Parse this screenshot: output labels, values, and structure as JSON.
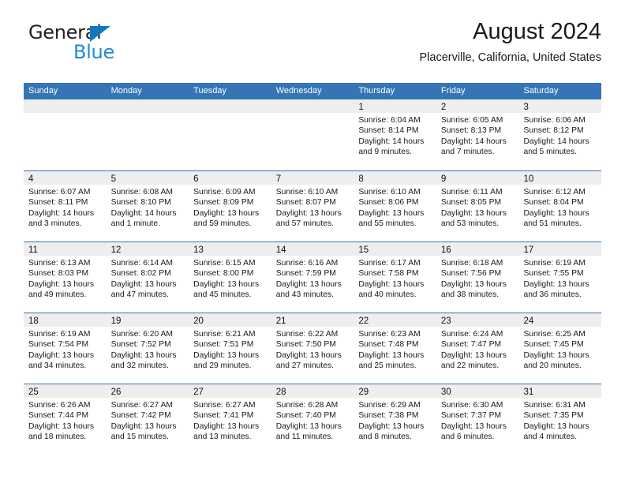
{
  "brand": {
    "name_top": "General",
    "name_bottom": "Blue",
    "triangle_color": "#1278be",
    "blue_color": "#1f8ad6"
  },
  "header": {
    "title": "August 2024",
    "subtitle": "Placerville, California, United States",
    "header_bar_color": "#3575b5",
    "day_band_color": "#eeeeee"
  },
  "weekdays": [
    "Sunday",
    "Monday",
    "Tuesday",
    "Wednesday",
    "Thursday",
    "Friday",
    "Saturday"
  ],
  "weeks": [
    [
      {
        "day": ""
      },
      {
        "day": ""
      },
      {
        "day": ""
      },
      {
        "day": ""
      },
      {
        "day": "1",
        "sunrise": "Sunrise: 6:04 AM",
        "sunset": "Sunset: 8:14 PM",
        "daylight_1": "Daylight: 14 hours",
        "daylight_2": "and 9 minutes."
      },
      {
        "day": "2",
        "sunrise": "Sunrise: 6:05 AM",
        "sunset": "Sunset: 8:13 PM",
        "daylight_1": "Daylight: 14 hours",
        "daylight_2": "and 7 minutes."
      },
      {
        "day": "3",
        "sunrise": "Sunrise: 6:06 AM",
        "sunset": "Sunset: 8:12 PM",
        "daylight_1": "Daylight: 14 hours",
        "daylight_2": "and 5 minutes."
      }
    ],
    [
      {
        "day": "4",
        "sunrise": "Sunrise: 6:07 AM",
        "sunset": "Sunset: 8:11 PM",
        "daylight_1": "Daylight: 14 hours",
        "daylight_2": "and 3 minutes."
      },
      {
        "day": "5",
        "sunrise": "Sunrise: 6:08 AM",
        "sunset": "Sunset: 8:10 PM",
        "daylight_1": "Daylight: 14 hours",
        "daylight_2": "and 1 minute."
      },
      {
        "day": "6",
        "sunrise": "Sunrise: 6:09 AM",
        "sunset": "Sunset: 8:09 PM",
        "daylight_1": "Daylight: 13 hours",
        "daylight_2": "and 59 minutes."
      },
      {
        "day": "7",
        "sunrise": "Sunrise: 6:10 AM",
        "sunset": "Sunset: 8:07 PM",
        "daylight_1": "Daylight: 13 hours",
        "daylight_2": "and 57 minutes."
      },
      {
        "day": "8",
        "sunrise": "Sunrise: 6:10 AM",
        "sunset": "Sunset: 8:06 PM",
        "daylight_1": "Daylight: 13 hours",
        "daylight_2": "and 55 minutes."
      },
      {
        "day": "9",
        "sunrise": "Sunrise: 6:11 AM",
        "sunset": "Sunset: 8:05 PM",
        "daylight_1": "Daylight: 13 hours",
        "daylight_2": "and 53 minutes."
      },
      {
        "day": "10",
        "sunrise": "Sunrise: 6:12 AM",
        "sunset": "Sunset: 8:04 PM",
        "daylight_1": "Daylight: 13 hours",
        "daylight_2": "and 51 minutes."
      }
    ],
    [
      {
        "day": "11",
        "sunrise": "Sunrise: 6:13 AM",
        "sunset": "Sunset: 8:03 PM",
        "daylight_1": "Daylight: 13 hours",
        "daylight_2": "and 49 minutes."
      },
      {
        "day": "12",
        "sunrise": "Sunrise: 6:14 AM",
        "sunset": "Sunset: 8:02 PM",
        "daylight_1": "Daylight: 13 hours",
        "daylight_2": "and 47 minutes."
      },
      {
        "day": "13",
        "sunrise": "Sunrise: 6:15 AM",
        "sunset": "Sunset: 8:00 PM",
        "daylight_1": "Daylight: 13 hours",
        "daylight_2": "and 45 minutes."
      },
      {
        "day": "14",
        "sunrise": "Sunrise: 6:16 AM",
        "sunset": "Sunset: 7:59 PM",
        "daylight_1": "Daylight: 13 hours",
        "daylight_2": "and 43 minutes."
      },
      {
        "day": "15",
        "sunrise": "Sunrise: 6:17 AM",
        "sunset": "Sunset: 7:58 PM",
        "daylight_1": "Daylight: 13 hours",
        "daylight_2": "and 40 minutes."
      },
      {
        "day": "16",
        "sunrise": "Sunrise: 6:18 AM",
        "sunset": "Sunset: 7:56 PM",
        "daylight_1": "Daylight: 13 hours",
        "daylight_2": "and 38 minutes."
      },
      {
        "day": "17",
        "sunrise": "Sunrise: 6:19 AM",
        "sunset": "Sunset: 7:55 PM",
        "daylight_1": "Daylight: 13 hours",
        "daylight_2": "and 36 minutes."
      }
    ],
    [
      {
        "day": "18",
        "sunrise": "Sunrise: 6:19 AM",
        "sunset": "Sunset: 7:54 PM",
        "daylight_1": "Daylight: 13 hours",
        "daylight_2": "and 34 minutes."
      },
      {
        "day": "19",
        "sunrise": "Sunrise: 6:20 AM",
        "sunset": "Sunset: 7:52 PM",
        "daylight_1": "Daylight: 13 hours",
        "daylight_2": "and 32 minutes."
      },
      {
        "day": "20",
        "sunrise": "Sunrise: 6:21 AM",
        "sunset": "Sunset: 7:51 PM",
        "daylight_1": "Daylight: 13 hours",
        "daylight_2": "and 29 minutes."
      },
      {
        "day": "21",
        "sunrise": "Sunrise: 6:22 AM",
        "sunset": "Sunset: 7:50 PM",
        "daylight_1": "Daylight: 13 hours",
        "daylight_2": "and 27 minutes."
      },
      {
        "day": "22",
        "sunrise": "Sunrise: 6:23 AM",
        "sunset": "Sunset: 7:48 PM",
        "daylight_1": "Daylight: 13 hours",
        "daylight_2": "and 25 minutes."
      },
      {
        "day": "23",
        "sunrise": "Sunrise: 6:24 AM",
        "sunset": "Sunset: 7:47 PM",
        "daylight_1": "Daylight: 13 hours",
        "daylight_2": "and 22 minutes."
      },
      {
        "day": "24",
        "sunrise": "Sunrise: 6:25 AM",
        "sunset": "Sunset: 7:45 PM",
        "daylight_1": "Daylight: 13 hours",
        "daylight_2": "and 20 minutes."
      }
    ],
    [
      {
        "day": "25",
        "sunrise": "Sunrise: 6:26 AM",
        "sunset": "Sunset: 7:44 PM",
        "daylight_1": "Daylight: 13 hours",
        "daylight_2": "and 18 minutes."
      },
      {
        "day": "26",
        "sunrise": "Sunrise: 6:27 AM",
        "sunset": "Sunset: 7:42 PM",
        "daylight_1": "Daylight: 13 hours",
        "daylight_2": "and 15 minutes."
      },
      {
        "day": "27",
        "sunrise": "Sunrise: 6:27 AM",
        "sunset": "Sunset: 7:41 PM",
        "daylight_1": "Daylight: 13 hours",
        "daylight_2": "and 13 minutes."
      },
      {
        "day": "28",
        "sunrise": "Sunrise: 6:28 AM",
        "sunset": "Sunset: 7:40 PM",
        "daylight_1": "Daylight: 13 hours",
        "daylight_2": "and 11 minutes."
      },
      {
        "day": "29",
        "sunrise": "Sunrise: 6:29 AM",
        "sunset": "Sunset: 7:38 PM",
        "daylight_1": "Daylight: 13 hours",
        "daylight_2": "and 8 minutes."
      },
      {
        "day": "30",
        "sunrise": "Sunrise: 6:30 AM",
        "sunset": "Sunset: 7:37 PM",
        "daylight_1": "Daylight: 13 hours",
        "daylight_2": "and 6 minutes."
      },
      {
        "day": "31",
        "sunrise": "Sunrise: 6:31 AM",
        "sunset": "Sunset: 7:35 PM",
        "daylight_1": "Daylight: 13 hours",
        "daylight_2": "and 4 minutes."
      }
    ]
  ]
}
